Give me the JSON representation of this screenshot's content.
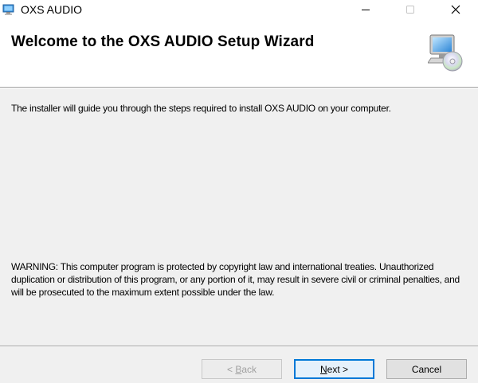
{
  "window": {
    "title": "OXS AUDIO",
    "app_icon": "installer-icon",
    "controls": {
      "minimize": "minimize-icon",
      "maximize": "maximize-icon",
      "close": "close-icon"
    }
  },
  "header": {
    "title": "Welcome to the OXS AUDIO Setup Wizard",
    "icon": "setup-computer-cd-icon"
  },
  "content": {
    "intro": "The installer will guide you through the steps required to install OXS AUDIO on your computer.",
    "warning": "WARNING: This computer program is protected by copyright law and international treaties. Unauthorized duplication or distribution of this program, or any portion of it, may result in severe civil or criminal penalties, and will be prosecuted to the maximum extent possible under the law."
  },
  "buttons": {
    "back": {
      "prefix": "< ",
      "mnemonic": "B",
      "rest": "ack",
      "enabled": false
    },
    "next": {
      "mnemonic": "N",
      "rest": "ext >",
      "enabled": true
    },
    "cancel": {
      "label": "Cancel",
      "enabled": true
    }
  },
  "colors": {
    "accent": "#0078d7",
    "background": "#f0f0f0",
    "header_bg": "#ffffff"
  }
}
